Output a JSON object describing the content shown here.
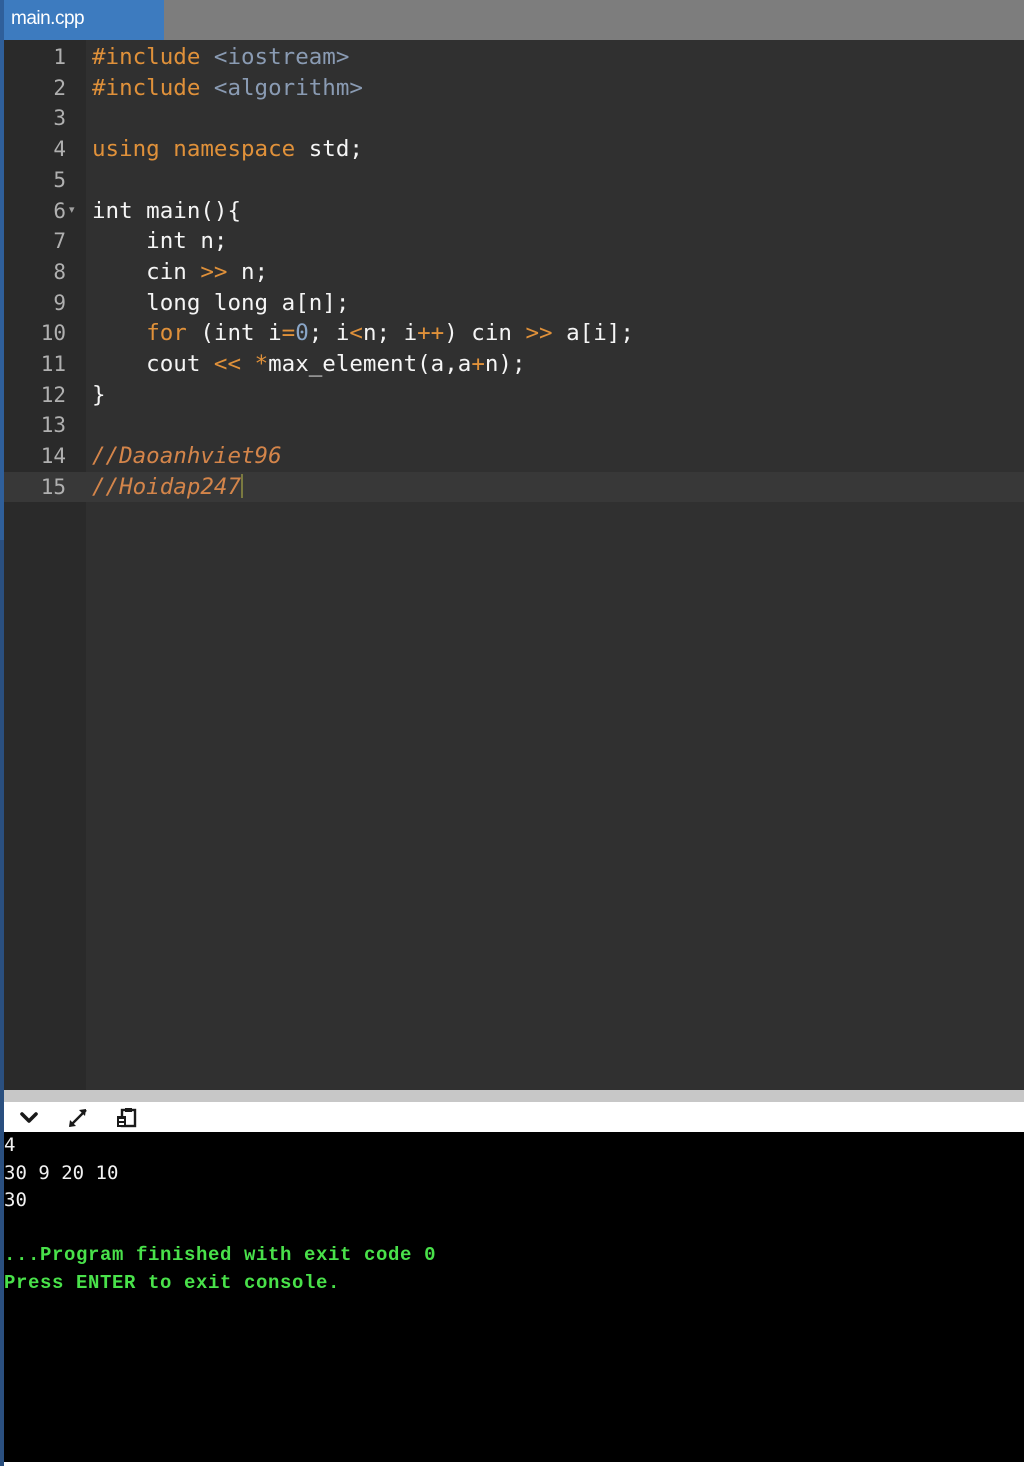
{
  "tab": {
    "filename": "main.cpp"
  },
  "editor": {
    "lines": [
      {
        "n": "1",
        "code": [
          [
            "inc",
            "#include "
          ],
          [
            "hdr",
            "<iostream>"
          ]
        ]
      },
      {
        "n": "2",
        "code": [
          [
            "inc",
            "#include "
          ],
          [
            "hdr",
            "<algorithm>"
          ]
        ]
      },
      {
        "n": "3",
        "code": []
      },
      {
        "n": "4",
        "code": [
          [
            "kw",
            "using"
          ],
          [
            "",
            " "
          ],
          [
            "kw",
            "namespace"
          ],
          [
            "",
            " std;"
          ]
        ]
      },
      {
        "n": "5",
        "code": []
      },
      {
        "n": "6",
        "fold": true,
        "code": [
          [
            "",
            "int main(){"
          ]
        ]
      },
      {
        "n": "7",
        "code": [
          [
            "",
            "    int n;"
          ]
        ]
      },
      {
        "n": "8",
        "code": [
          [
            "",
            "    cin "
          ],
          [
            "op",
            ">>"
          ],
          [
            "",
            " n;"
          ]
        ]
      },
      {
        "n": "9",
        "code": [
          [
            "",
            "    long long a[n];"
          ]
        ]
      },
      {
        "n": "10",
        "code": [
          [
            "",
            "    "
          ],
          [
            "kw",
            "for"
          ],
          [
            "",
            " (int i"
          ],
          [
            "op",
            "="
          ],
          [
            "num",
            "0"
          ],
          [
            "",
            "; i"
          ],
          [
            "op",
            "<"
          ],
          [
            "",
            "n; i"
          ],
          [
            "op",
            "++"
          ],
          [
            "",
            ") cin "
          ],
          [
            "op",
            ">>"
          ],
          [
            "",
            " a[i];"
          ]
        ]
      },
      {
        "n": "11",
        "code": [
          [
            "",
            "    cout "
          ],
          [
            "op",
            "<<"
          ],
          [
            "",
            " "
          ],
          [
            "op",
            "*"
          ],
          [
            "",
            "max_element(a,a"
          ],
          [
            "op",
            "+"
          ],
          [
            "",
            "n);"
          ]
        ]
      },
      {
        "n": "12",
        "code": [
          [
            "",
            "}"
          ]
        ]
      },
      {
        "n": "13",
        "code": []
      },
      {
        "n": "14",
        "code": [
          [
            "cm",
            "//Daoanhviet96"
          ]
        ]
      },
      {
        "n": "15",
        "active": true,
        "caret": true,
        "code": [
          [
            "cm",
            "//Hoidap247"
          ]
        ]
      }
    ]
  },
  "console": {
    "toolbar": {
      "collapse_icon": "chevron-down-icon",
      "expand_icon": "expand-arrows-icon",
      "copy_icon": "clipboard-icon"
    },
    "output_lines": [
      "4",
      "30 9 20 10",
      "30",
      ""
    ],
    "finish_message": "...Program finished with exit code 0",
    "exit_prompt": "Press ENTER to exit console."
  },
  "colors": {
    "tab_active": "#3d7bbf",
    "tab_bar": "#7d7d7d",
    "editor_bg": "#303030",
    "gutter_bg": "#2a2a2a",
    "keyword": "#e0913a",
    "header": "#8a9bb3",
    "comment": "#d4854a",
    "console_bg": "#000000",
    "console_success": "#49e14a"
  }
}
